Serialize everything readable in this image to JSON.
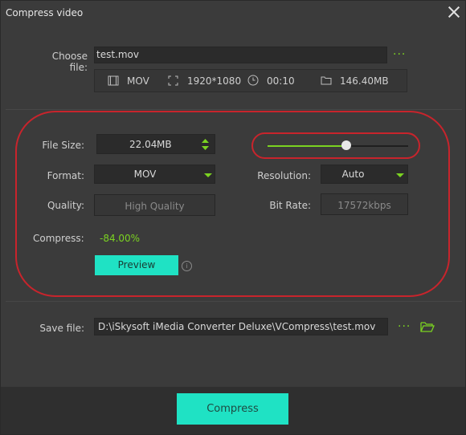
{
  "window": {
    "title": "Compress video"
  },
  "choose_file": {
    "label": "Choose file:",
    "value": "test.mov"
  },
  "file_info": {
    "format": "MOV",
    "resolution": "1920*1080",
    "duration": "00:10",
    "size": "146.40MB"
  },
  "settings": {
    "file_size_label": "File Size:",
    "file_size_value": "22.04",
    "file_size_unit": "MB",
    "slider_level": 0.56,
    "format_label": "Format:",
    "format_value": "MOV",
    "resolution_label": "Resolution:",
    "resolution_value": "Auto",
    "quality_label": "Quality:",
    "quality_placeholder": "High Quality",
    "bitrate_label": "Bit Rate:",
    "bitrate_placeholder": "17572kbps",
    "compress_label": "Compress:",
    "compress_value": "-84.00%",
    "preview_label": "Preview"
  },
  "save_file": {
    "label": "Save file:",
    "value": "D:\\iSkysoft iMedia Converter Deluxe\\VCompress\\test.mov"
  },
  "actions": {
    "compress_label": "Compress"
  },
  "colors": {
    "accent": "#1fe2c4",
    "green": "#7bd321",
    "highlight": "#c8242c"
  }
}
